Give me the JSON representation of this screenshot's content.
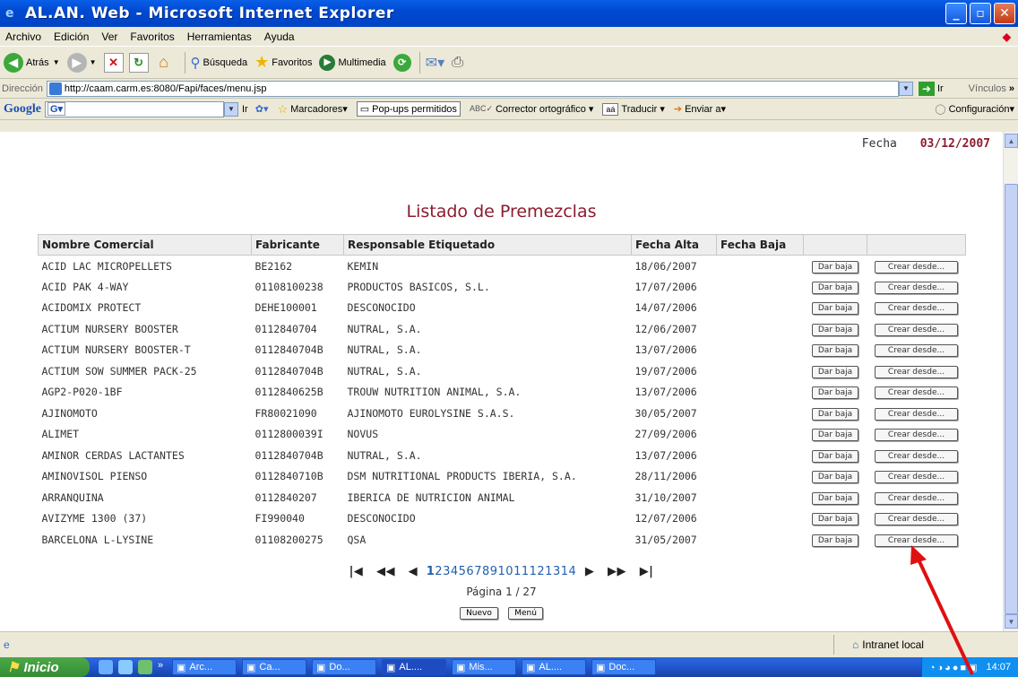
{
  "window": {
    "title": "AL.AN. Web - Microsoft Internet Explorer"
  },
  "menu": [
    "Archivo",
    "Edición",
    "Ver",
    "Favoritos",
    "Herramientas",
    "Ayuda"
  ],
  "toolbar": {
    "back": "Atrás",
    "search": "Búsqueda",
    "favorites": "Favoritos",
    "multimedia": "Multimedia"
  },
  "address": {
    "label": "Dirección",
    "url": "http://caam.carm.es:8080/Fapi/faces/menu.jsp",
    "go": "Ir",
    "links": "Vínculos"
  },
  "google": {
    "logo": "Google",
    "go": "Ir",
    "bookmarks": "Marcadores",
    "popups": "Pop-ups permitidos",
    "spell": "Corrector ortográfico",
    "translate": "Traducir",
    "send": "Enviar a",
    "settings": "Configuración"
  },
  "page": {
    "date_label": "Fecha",
    "date_value": "03/12/2007",
    "title": "Listado de Premezclas",
    "columns": [
      "Nombre Comercial",
      "Fabricante",
      "Responsable Etiquetado",
      "Fecha Alta",
      "Fecha Baja"
    ],
    "rows": [
      {
        "nombre": "ACID LAC MICROPELLETS",
        "fabricante": "BE2162",
        "responsable": "KEMIN",
        "alta": "18/06/2007",
        "baja": ""
      },
      {
        "nombre": "ACID PAK 4-WAY",
        "fabricante": "01108100238",
        "responsable": "PRODUCTOS BASICOS, S.L.",
        "alta": "17/07/2006",
        "baja": ""
      },
      {
        "nombre": "ACIDOMIX PROTECT",
        "fabricante": "DEHE100001",
        "responsable": "DESCONOCIDO",
        "alta": "14/07/2006",
        "baja": ""
      },
      {
        "nombre": "ACTIUM NURSERY BOOSTER",
        "fabricante": "0112840704",
        "responsable": "NUTRAL, S.A.",
        "alta": "12/06/2007",
        "baja": ""
      },
      {
        "nombre": "ACTIUM NURSERY BOOSTER-T",
        "fabricante": "0112840704B",
        "responsable": "NUTRAL, S.A.",
        "alta": "13/07/2006",
        "baja": ""
      },
      {
        "nombre": "ACTIUM SOW SUMMER PACK-25",
        "fabricante": "0112840704B",
        "responsable": "NUTRAL, S.A.",
        "alta": "19/07/2006",
        "baja": ""
      },
      {
        "nombre": "AGP2-P020-1BF",
        "fabricante": "0112840625B",
        "responsable": "TROUW NUTRITION ANIMAL, S.A.",
        "alta": "13/07/2006",
        "baja": ""
      },
      {
        "nombre": "AJINOMOTO",
        "fabricante": "FR80021090",
        "responsable": "AJINOMOTO EUROLYSINE S.A.S.",
        "alta": "30/05/2007",
        "baja": ""
      },
      {
        "nombre": "ALIMET",
        "fabricante": "0112800039I",
        "responsable": "NOVUS",
        "alta": "27/09/2006",
        "baja": ""
      },
      {
        "nombre": "AMINOR CERDAS LACTANTES",
        "fabricante": "0112840704B",
        "responsable": "NUTRAL, S.A.",
        "alta": "13/07/2006",
        "baja": ""
      },
      {
        "nombre": "AMINOVISOL PIENSO",
        "fabricante": "0112840710B",
        "responsable": "DSM NUTRITIONAL PRODUCTS IBERIA, S.A.",
        "alta": "28/11/2006",
        "baja": ""
      },
      {
        "nombre": "ARRANQUINA",
        "fabricante": "0112840207",
        "responsable": "IBERICA DE NUTRICION ANIMAL",
        "alta": "31/10/2007",
        "baja": ""
      },
      {
        "nombre": "AVIZYME 1300 (37)",
        "fabricante": "FI990040",
        "responsable": "DESCONOCIDO",
        "alta": "12/07/2006",
        "baja": ""
      },
      {
        "nombre": "BARCELONA L-LYSINE",
        "fabricante": "01108200275",
        "responsable": "QSA",
        "alta": "31/05/2007",
        "baja": ""
      }
    ],
    "btn_baja": "Dar baja",
    "btn_crear": "Crear desde...",
    "pages": [
      "1",
      "2",
      "3",
      "4",
      "5",
      "6",
      "7",
      "8",
      "9",
      "10",
      "11",
      "12",
      "13",
      "14"
    ],
    "page_info": "Página 1 / 27",
    "btn_nuevo": "Nuevo",
    "btn_menu": "Menú"
  },
  "status": {
    "zone": "Intranet local"
  },
  "taskbar": {
    "start": "Inicio",
    "items": [
      "Arc...",
      "Ca...",
      "Do...",
      "AL....",
      "Mis...",
      "AL....",
      "Doc..."
    ],
    "clock": "14:07"
  },
  "colors": {
    "title_accent": "#8b1c2e",
    "link": "#1f5fb0",
    "annotation_arrow": "#e01010"
  }
}
